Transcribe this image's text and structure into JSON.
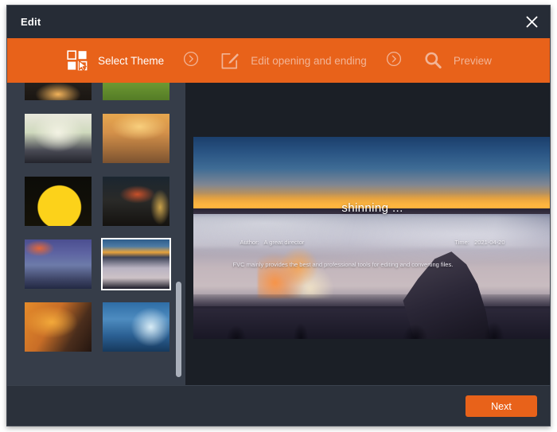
{
  "window": {
    "title": "Edit",
    "close_icon": "close-icon",
    "accent_color": "#e8621a",
    "titlebar_color": "#262c36",
    "panel_color": "#2b313b",
    "sidebar_color": "#363d49"
  },
  "steps": [
    {
      "label": "Select Theme",
      "icon": "theme-grid-cursor-icon",
      "state": "active"
    },
    {
      "label": "Edit opening and ending",
      "icon": "pencil-square-icon",
      "state": "inactive"
    },
    {
      "label": "Preview",
      "icon": "magnifier-icon",
      "state": "inactive"
    }
  ],
  "step_separator_icon": "chevron-right-circle-icon",
  "themes": {
    "scrollbar": {
      "position_percent": 66
    },
    "selected_index": 7,
    "items": [
      {
        "name": "dark-still-life",
        "selected": false
      },
      {
        "name": "golf-course",
        "selected": false
      },
      {
        "name": "living-room-garden-view",
        "selected": false
      },
      {
        "name": "family-sunset-road",
        "selected": false
      },
      {
        "name": "halloween-moon",
        "selected": false
      },
      {
        "name": "haunted-carnival",
        "selected": false
      },
      {
        "name": "winter-mountain-lake",
        "selected": false
      },
      {
        "name": "sea-of-clouds-sunset",
        "selected": true
      },
      {
        "name": "cave-climber-sunset",
        "selected": false
      },
      {
        "name": "ice-cave-blue",
        "selected": false
      }
    ]
  },
  "preview": {
    "title": "shinning ...",
    "author_label": "Author:",
    "author_value": "A great director",
    "time_label": "Time:",
    "time_value": "2021-04-20",
    "description": "FVC mainly provides the best and professional tools for editing and converting files."
  },
  "footer": {
    "next_label": "Next"
  }
}
